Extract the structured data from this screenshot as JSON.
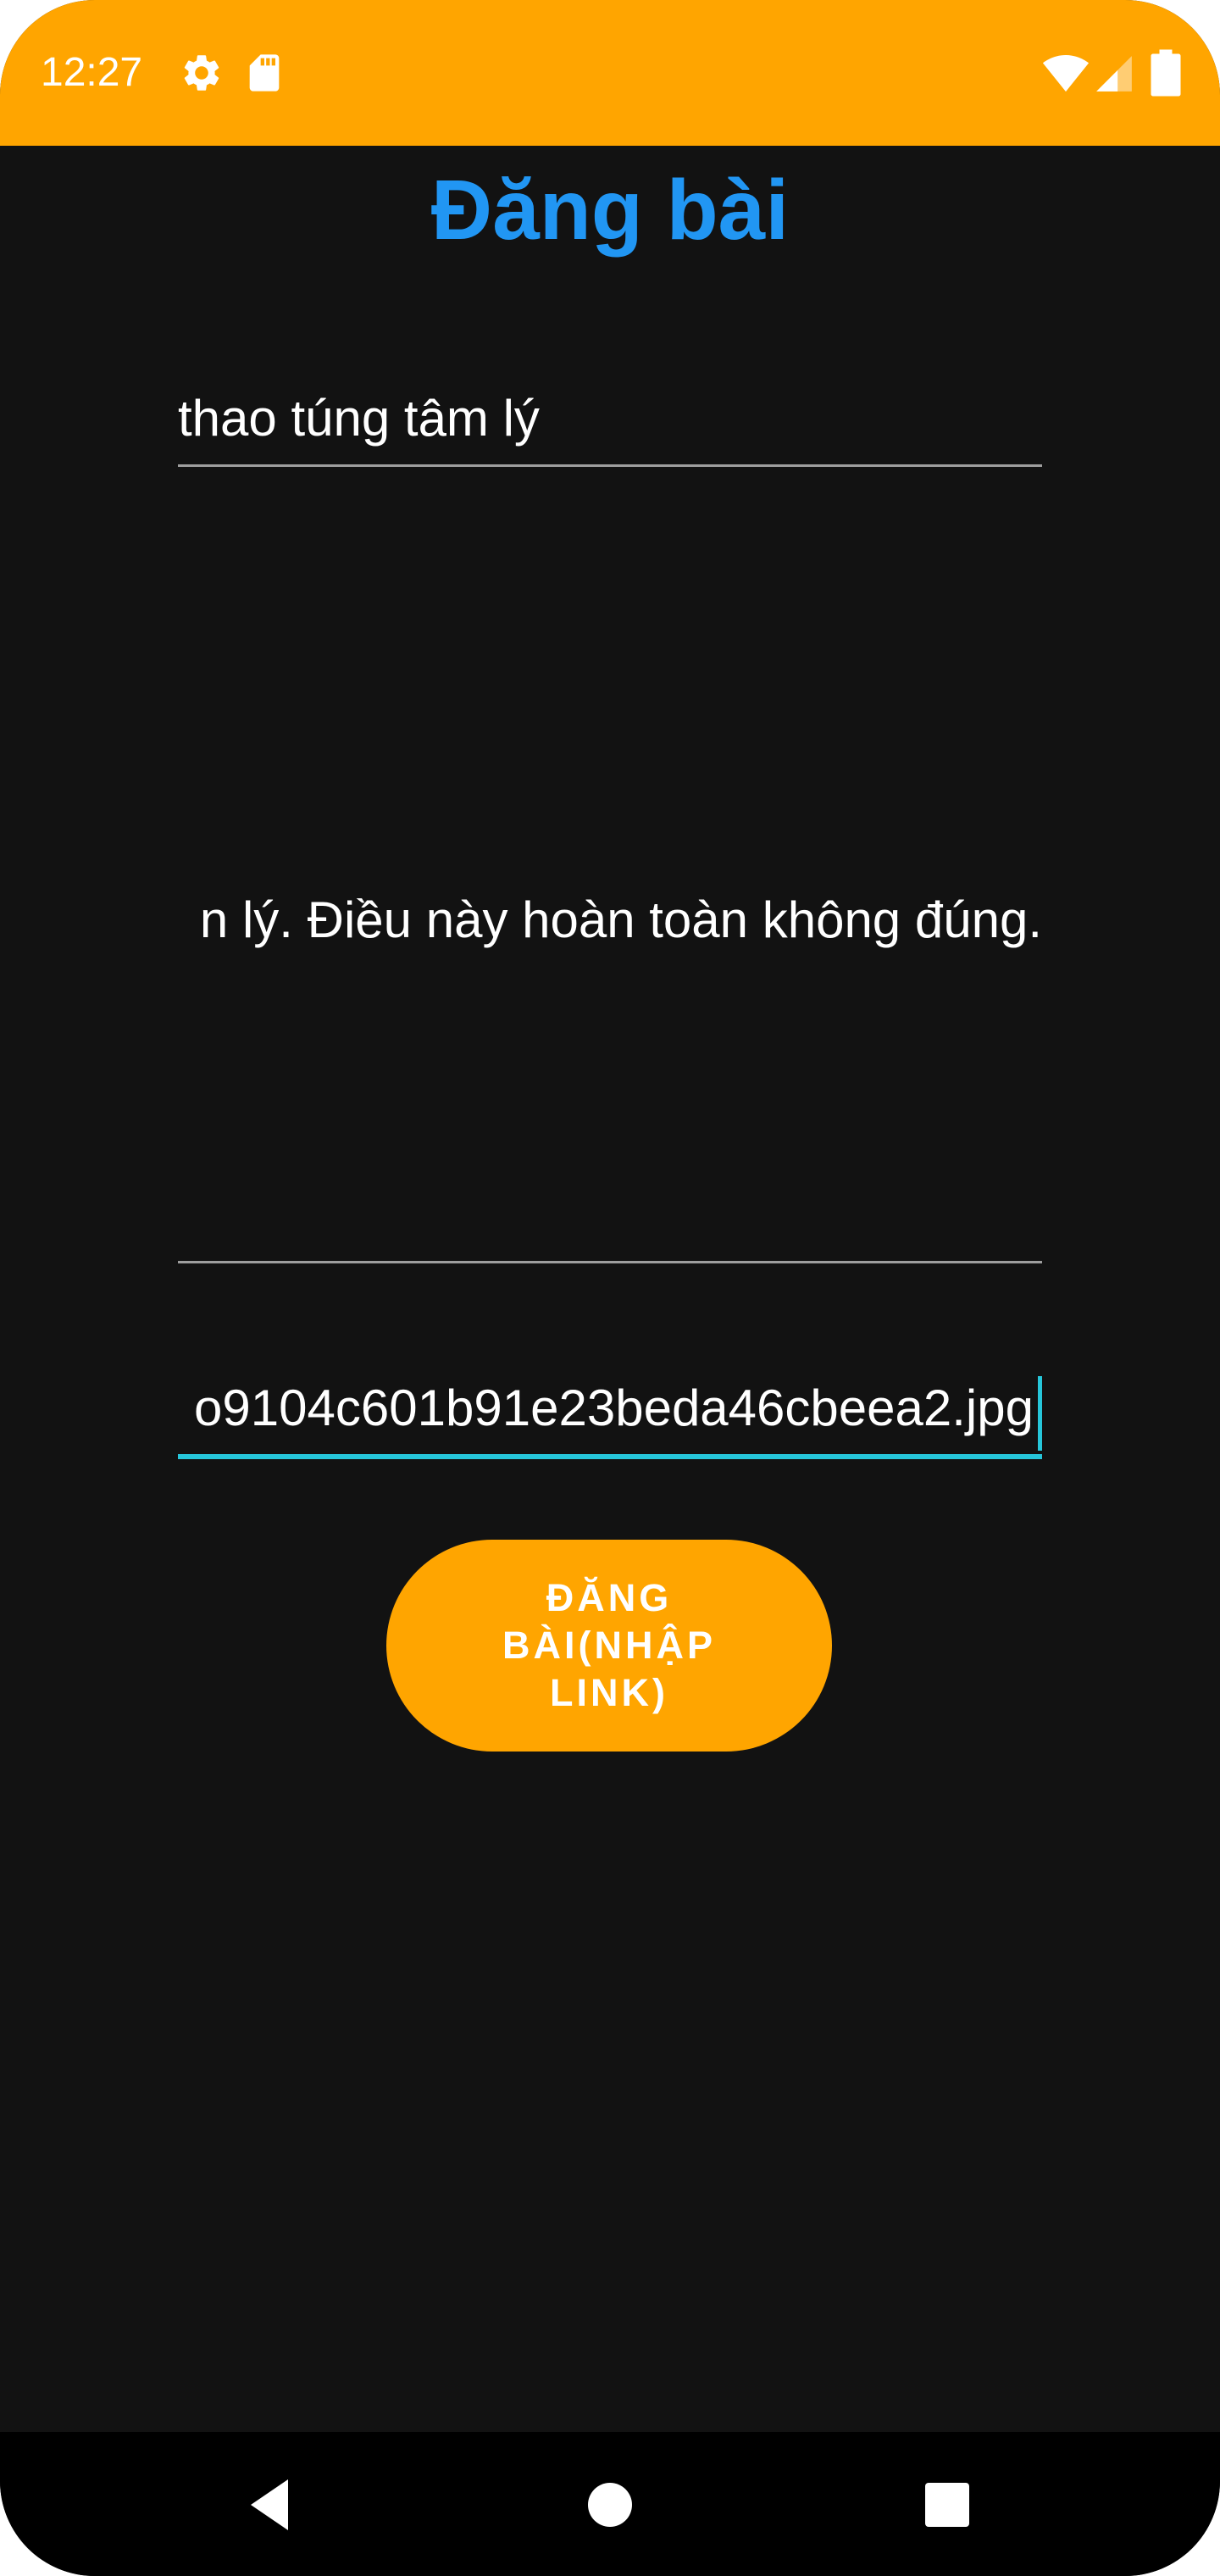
{
  "status_bar": {
    "time": "12:27",
    "color": "#FFA500",
    "icons": [
      "gear-icon",
      "sd-card-icon",
      "wifi-icon",
      "cell-signal-icon",
      "battery-icon"
    ]
  },
  "page": {
    "title": "Đăng bài",
    "title_color": "#2196F3",
    "background": "#121212"
  },
  "form": {
    "title_value": "thao túng tâm lý",
    "content_value": "n lý. Điều này hoàn toàn không đúng.",
    "link_value": "o9104c601b91e23beda46cbeea2.jpg",
    "focused_underline_color": "#26C6DA"
  },
  "button": {
    "label": "ĐĂNG BÀI(NHẬP LINK)",
    "color": "#FFA500"
  },
  "nav_bar": {
    "icons": [
      "back-icon",
      "home-icon",
      "recents-icon"
    ]
  }
}
